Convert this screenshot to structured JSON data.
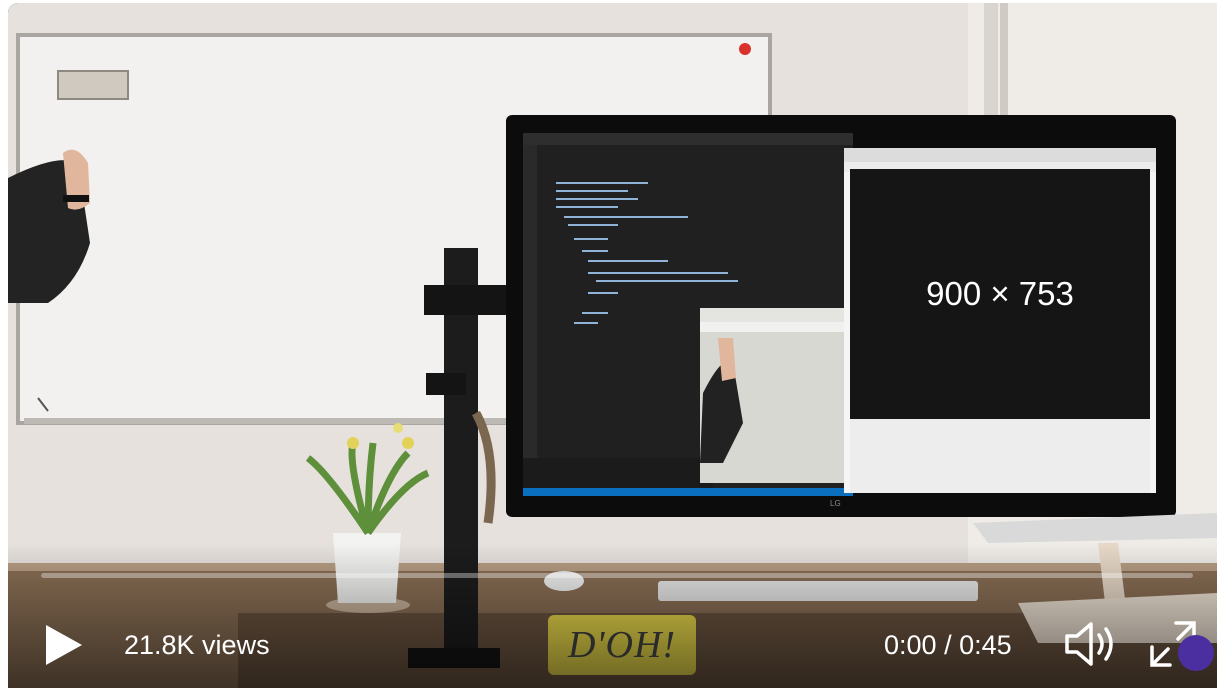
{
  "video": {
    "views_label": "21.8K views",
    "current_time": "0:00",
    "duration": "0:45",
    "time_separator": " / ",
    "progress_fraction": 0.0
  },
  "monitor": {
    "preview_label": "900 × 753",
    "brand": "LG"
  },
  "desk": {
    "sign_text": "D'OH!"
  },
  "colors": {
    "accent_dot": "#4b2fa0",
    "control_text": "#ffffff"
  },
  "icons": {
    "play": "play-icon",
    "volume": "volume-icon",
    "fullscreen": "fullscreen-icon"
  }
}
